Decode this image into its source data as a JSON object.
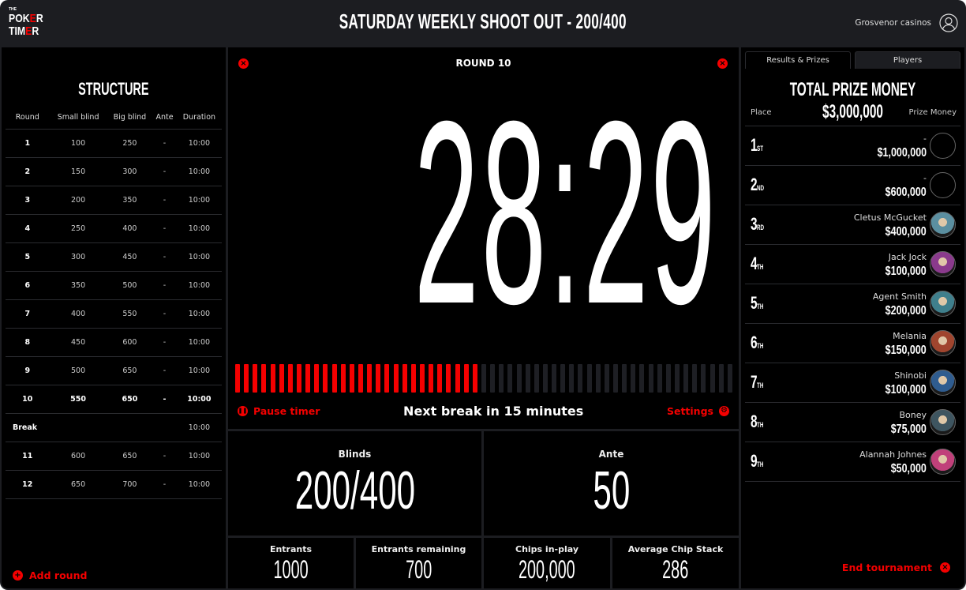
{
  "header": {
    "logo": {
      "the": "THE",
      "line1_a": "POK",
      "line1_b": "E",
      "line1_c": "R",
      "line2_a": "TIM",
      "line2_b": "E",
      "line2_c": "R"
    },
    "title": "SATURDAY WEEKLY SHOOT OUT - 200/400",
    "user_name": "Grosvenor casinos",
    "user_icon": "user-circle-icon"
  },
  "structure": {
    "title": "STRUCTURE",
    "columns": [
      "Round",
      "Small blind",
      "Big blind",
      "Ante",
      "Duration"
    ],
    "rows": [
      {
        "round": "1",
        "small": "100",
        "big": "250",
        "ante": "-",
        "duration": "10:00"
      },
      {
        "round": "2",
        "small": "150",
        "big": "300",
        "ante": "-",
        "duration": "10:00"
      },
      {
        "round": "3",
        "small": "200",
        "big": "350",
        "ante": "-",
        "duration": "10:00"
      },
      {
        "round": "4",
        "small": "250",
        "big": "400",
        "ante": "-",
        "duration": "10:00"
      },
      {
        "round": "5",
        "small": "300",
        "big": "450",
        "ante": "-",
        "duration": "10:00"
      },
      {
        "round": "6",
        "small": "350",
        "big": "500",
        "ante": "-",
        "duration": "10:00"
      },
      {
        "round": "7",
        "small": "400",
        "big": "550",
        "ante": "-",
        "duration": "10:00"
      },
      {
        "round": "8",
        "small": "450",
        "big": "600",
        "ante": "-",
        "duration": "10:00"
      },
      {
        "round": "9",
        "small": "500",
        "big": "650",
        "ante": "-",
        "duration": "10:00"
      },
      {
        "round": "10",
        "small": "550",
        "big": "650",
        "ante": "-",
        "duration": "10:00"
      },
      {
        "round": "Break",
        "small": "",
        "big": "",
        "ante": "",
        "duration": "10:00"
      },
      {
        "round": "11",
        "small": "600",
        "big": "650",
        "ante": "-",
        "duration": "10:00"
      },
      {
        "round": "12",
        "small": "650",
        "big": "700",
        "ante": "-",
        "duration": "10:00"
      }
    ],
    "add_round_label": "Add round"
  },
  "timer": {
    "round_label": "ROUND 10",
    "time": "28:29",
    "progress_fraction": 0.49,
    "progress_segments": 57,
    "pause_label": "Pause timer",
    "next_break": "Next break in 15 minutes",
    "settings_label": "Settings"
  },
  "stats": {
    "blinds": {
      "label": "Blinds",
      "value": "200/400"
    },
    "ante": {
      "label": "Ante",
      "value": "50"
    },
    "entrants": {
      "label": "Entrants",
      "value": "1000"
    },
    "entrants_remaining": {
      "label": "Entrants remaining",
      "value": "700"
    },
    "chips_in_play": {
      "label": "Chips in-play",
      "value": "200,000"
    },
    "avg_chip_stack": {
      "label": "Average Chip Stack",
      "value": "286"
    }
  },
  "results": {
    "tabs": [
      {
        "label": "Results & Prizes",
        "active": true
      },
      {
        "label": "Players",
        "active": false
      }
    ],
    "total_prize": "TOTAL PRIZE MONEY $3,000,000",
    "place_header": "Place",
    "prize_header": "Prize Money",
    "prizes": [
      {
        "num": "1",
        "suffix": "ST",
        "name": "-",
        "amount": "$1,000,000",
        "avatar": "",
        "color": ""
      },
      {
        "num": "2",
        "suffix": "ND",
        "name": "-",
        "amount": "$600,000",
        "avatar": "",
        "color": ""
      },
      {
        "num": "3",
        "suffix": "RD",
        "name": "Cletus McGucket",
        "amount": "$400,000",
        "avatar": "player-avatar",
        "color": "#5b8fa0"
      },
      {
        "num": "4",
        "suffix": "TH",
        "name": "Jack Jock",
        "amount": "$100,000",
        "avatar": "player-avatar",
        "color": "#8a3a8c"
      },
      {
        "num": "5",
        "suffix": "TH",
        "name": "Agent Smith",
        "amount": "$200,000",
        "avatar": "player-avatar",
        "color": "#3f7f8c"
      },
      {
        "num": "6",
        "suffix": "TH",
        "name": "Melania",
        "amount": "$150,000",
        "avatar": "player-avatar",
        "color": "#a0452e"
      },
      {
        "num": "7",
        "suffix": "TH",
        "name": "Shinobi",
        "amount": "$100,000",
        "avatar": "player-avatar",
        "color": "#2f5c8f"
      },
      {
        "num": "8",
        "suffix": "TH",
        "name": "Boney",
        "amount": "$75,000",
        "avatar": "player-avatar",
        "color": "#3e5560"
      },
      {
        "num": "9",
        "suffix": "TH",
        "name": "Alannah Johnes",
        "amount": "$50,000",
        "avatar": "player-avatar",
        "color": "#c0407a"
      }
    ],
    "end_label": "End tournament"
  },
  "colors": {
    "accent": "#f40000",
    "panel": "#000000",
    "frame": "#1c1d21",
    "bar_off": "#1e1f24"
  }
}
